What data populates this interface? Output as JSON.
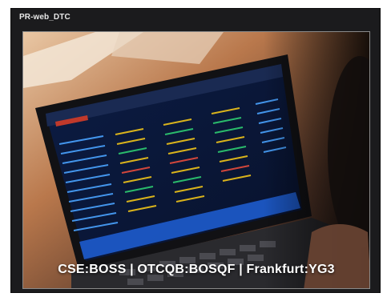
{
  "card": {
    "title": "PR-web_DTC"
  },
  "photo": {
    "caption": "CSE:BOSS | OTCQB:BOSQF | Frankfurt:YG3"
  }
}
